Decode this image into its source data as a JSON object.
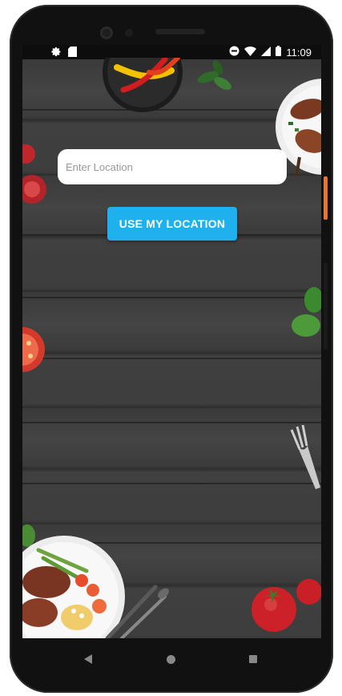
{
  "status_bar": {
    "time": "11:09",
    "left_icons": [
      "settings-gear-icon",
      "sd-card-icon"
    ],
    "right_icons": [
      "do-not-disturb-icon",
      "wifi-icon",
      "signal-icon",
      "battery-icon"
    ]
  },
  "location_form": {
    "input_placeholder": "Enter Location",
    "input_value": "",
    "button_label": "USE MY LOCATION"
  },
  "colors": {
    "accent": "#1eb1ee",
    "background_wood": "#3b3b3b",
    "side_button": "#e97533"
  },
  "navigation": {
    "buttons": [
      "back-icon",
      "home-icon",
      "recents-icon"
    ]
  }
}
